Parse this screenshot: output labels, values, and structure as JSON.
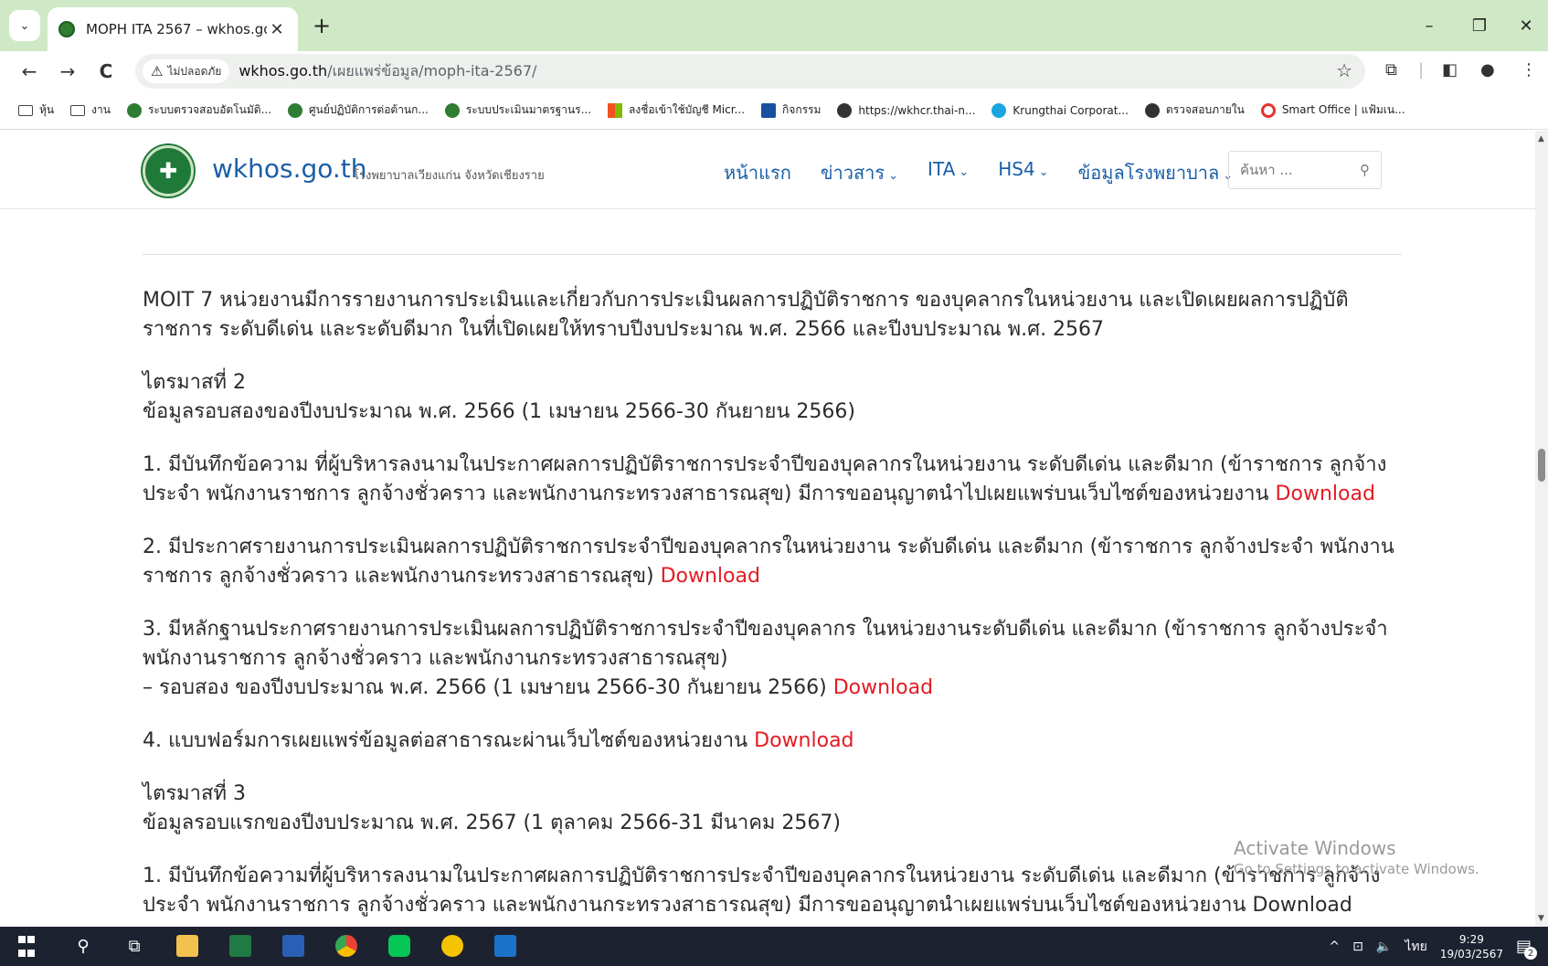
{
  "browser": {
    "tab": {
      "title": "MOPH ITA 2567 – wkhos.go.th",
      "close_glyph": "✕"
    },
    "new_tab_glyph": "+",
    "window_controls": {
      "minimize": "–",
      "restore": "❐",
      "close": "✕"
    },
    "nav": {
      "back": "←",
      "forward": "→",
      "reload": "C"
    },
    "address": {
      "security_label": "ไม่ปลอดภัย",
      "host": "wkhos.go.th",
      "path": "/เผยแพร่ข้อมูล/moph-ita-2567/"
    },
    "bookmarks": [
      {
        "label": "หุ้น",
        "icon": "folder"
      },
      {
        "label": "งาน",
        "icon": "folder"
      },
      {
        "label": "ระบบตรวจสอบอัตโนมัติ...",
        "icon": "green"
      },
      {
        "label": "ศูนย์ปฏิบัติการต่อต้านก...",
        "icon": "green"
      },
      {
        "label": "ระบบประเมินมาตรฐานร...",
        "icon": "green"
      },
      {
        "label": "ลงชื่อเข้าใช้บัญชี Micr...",
        "icon": "ms"
      },
      {
        "label": "กิจกรรม",
        "icon": "cal"
      },
      {
        "label": "https://wkhcr.thai-n...",
        "icon": "globe"
      },
      {
        "label": "Krungthai Corporat...",
        "icon": "ktb"
      },
      {
        "label": "ตรวจสอบภายใน",
        "icon": "globe"
      },
      {
        "label": "Smart Office | แฟ้มเน...",
        "icon": "ring"
      }
    ]
  },
  "site": {
    "name": "wkhos.go.th",
    "subtitle": "โรงพยาบาลเวียงแก่น จังหวัดเชียงราย",
    "nav": [
      {
        "label": "หน้าแรก",
        "caret": ""
      },
      {
        "label": "ข่าวสาร",
        "caret": "⌄"
      },
      {
        "label": "ITA",
        "caret": "⌄"
      },
      {
        "label": "HS4",
        "caret": "⌄"
      },
      {
        "label": "ข้อมูลโรงพยาบาล",
        "caret": "⌄"
      }
    ],
    "search_placeholder": "ค้นหา ..."
  },
  "content": {
    "intro": "MOIT 7 หน่วยงานมีการรายงานการประเมินและเกี่ยวกับการประเมินผลการปฏิบัติราชการ ของบุคลากรในหน่วยงาน และเปิดเผยผลการปฏิบัติราชการ ระดับดีเด่น และระดับดีมาก ในที่เปิดเผยให้ทราบปีงบประมาณ พ.ศ. 2566 และปีงบประมาณ พ.ศ. 2567",
    "q2": {
      "heading": "ไตรมาสที่ 2",
      "sub": "ข้อมูลรอบสองของปีงบประมาณ พ.ศ. 2566 (1 เมษายน 2566-30 กันยายน 2566)",
      "item1": "1. มีบันทึกข้อความ ที่ผู้บริหารลงนามในประกาศผลการปฏิบัติราชการประจำปีของบุคลากรในหน่วยงาน ระดับดีเด่น และดีมาก (ข้าราชการ ลูกจ้างประจำ พนักงานราชการ ลูกจ้างชั่วคราว และพนักงานกระทรวงสาธารณสุข) มีการขออนุญาตนำไปเผยแพร่บนเว็บไซต์ของหน่วยงาน",
      "item2": "2. มีประกาศรายงานการประเมินผลการปฏิบัติราชการประจำปีของบุคลากรในหน่วยงาน ระดับดีเด่น และดีมาก (ข้าราชการ ลูกจ้างประจำ พนักงานราชการ ลูกจ้างชั่วคราว และพนักงานกระทรวงสาธารณสุข)",
      "item3a": "3. มีหลักฐานประกาศรายงานการประเมินผลการปฏิบัติราชการประจำปีของบุคลากร ในหน่วยงานระดับดีเด่น และดีมาก (ข้าราชการ ลูกจ้างประจำ พนักงานราชการ ลูกจ้างชั่วคราว และพนักงานกระทรวงสาธารณสุข)",
      "item3b": "– รอบสอง ของปีงบประมาณ พ.ศ. 2566 (1 เมษายน 2566-30 กันยายน 2566)",
      "item4": "4. แบบฟอร์มการเผยแพร่ข้อมูลต่อสาธารณะผ่านเว็บไซต์ของหน่วยงาน"
    },
    "q3": {
      "heading": "ไตรมาสที่ 3",
      "sub": "ข้อมูลรอบแรกของปีงบประมาณ พ.ศ. 2567 (1 ตุลาคม 2566-31 มีนาคม 2567)",
      "item1": "1. มีบันทึกข้อความที่ผู้บริหารลงนามในประกาศผลการปฏิบัติราชการประจำปีของบุคลากรในหน่วยงาน ระดับดีเด่น และดีมาก (ข้าราชการ ลูกจ้างประจำ พนักงานราชการ ลูกจ้างชั่วคราว และพนักงานกระทรวงสาธารณสุข) มีการขออนุญาตนำเผยแพร่บนเว็บไซต์ของหน่วยงาน"
    },
    "download_label": "Download"
  },
  "watermark": {
    "line1": "Activate Windows",
    "line2": "Go to Settings to activate Windows."
  },
  "taskbar": {
    "language": "ไทย",
    "time": "9:29",
    "date": "19/03/2567",
    "notification_count": "2"
  },
  "colors": {
    "tabstrip": "#cfe9c6",
    "link_blue": "#1a5fa8",
    "download_red": "#e31b23",
    "taskbar": "#1d2230"
  }
}
